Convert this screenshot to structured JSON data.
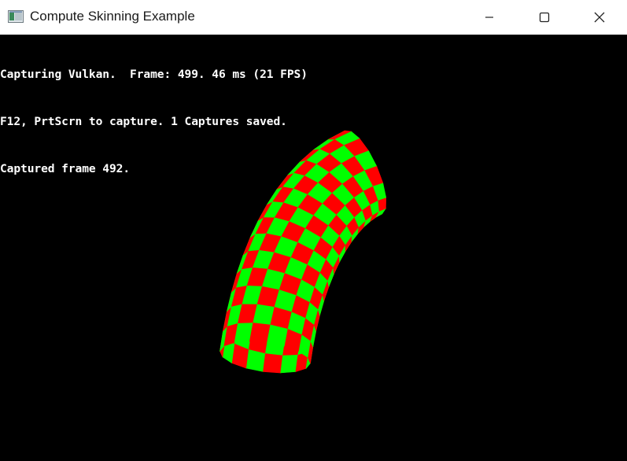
{
  "window": {
    "title": "Compute Skinning Example",
    "icon": "app-window-icon",
    "controls": {
      "minimize_icon": "minimize-icon",
      "maximize_icon": "maximize-icon",
      "close_icon": "close-icon"
    }
  },
  "overlay": {
    "lines": [
      "Capturing Vulkan.  Frame: 499. 46 ms (21 FPS)",
      "F12, PrtScrn to capture. 1 Captures saved.",
      "Captured frame 492."
    ]
  },
  "scene": {
    "object": "checkered-bent-tube",
    "colors": {
      "background": "#000000",
      "checker_a": "#ff0000",
      "checker_b": "#00ff00"
    }
  }
}
